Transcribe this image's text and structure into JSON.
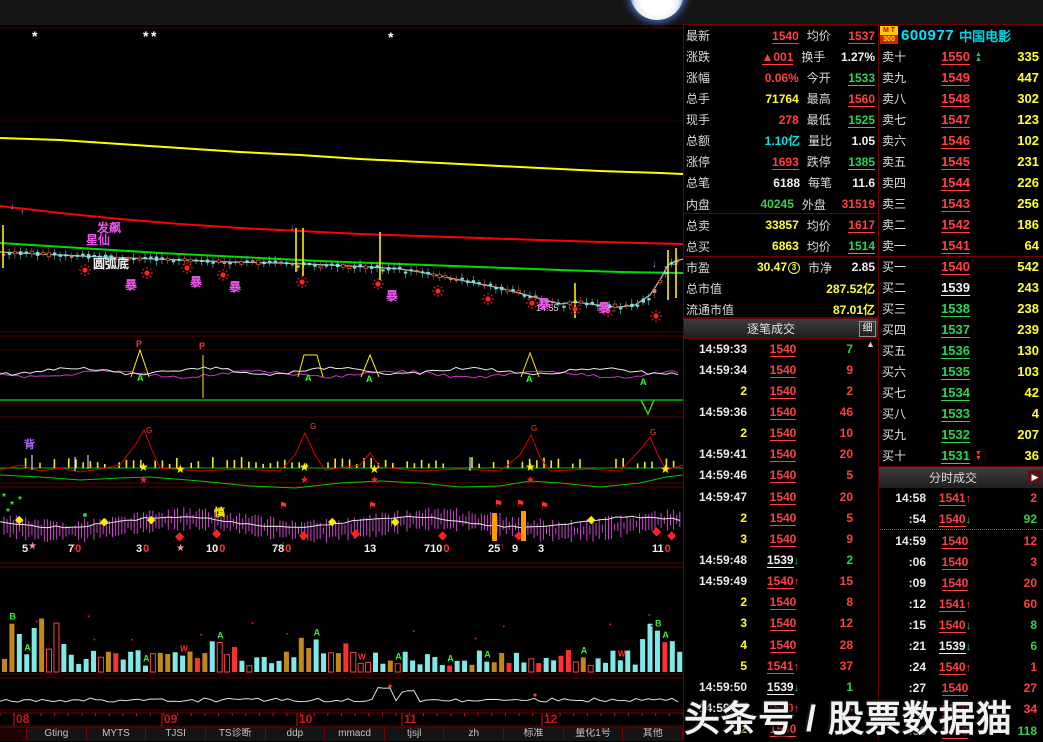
{
  "watermark": "头条号 / 股票数据猫",
  "stock": {
    "badge_top": "M T",
    "badge_bottom": "300",
    "code": "600977",
    "name": "中国电影"
  },
  "icons": {
    "up2": "▲",
    "down2": "▼",
    "up": "↑",
    "down": "↓",
    "scroll_up": "▲",
    "more": "▶",
    "pe_info": "3"
  },
  "quote_rows": [
    {
      "l1": "最新",
      "v1": "1540",
      "c1": "r u",
      "l2": "均价",
      "v2": "1537",
      "c2": "r u"
    },
    {
      "l1": "涨跌",
      "v1": "▲001",
      "c1": "r u",
      "l2": "换手",
      "v2": "1.27%",
      "c2": "w"
    },
    {
      "l1": "涨幅",
      "v1": "0.06%",
      "c1": "r",
      "l2": "今开",
      "v2": "1533",
      "c2": "g u"
    },
    {
      "l1": "总手",
      "v1": "71764",
      "c1": "y",
      "l2": "最高",
      "v2": "1560",
      "c2": "r u"
    },
    {
      "l1": "现手",
      "v1": "278",
      "c1": "r",
      "l2": "最低",
      "v2": "1525",
      "c2": "g u"
    },
    {
      "l1": "总额",
      "v1": "1.10亿",
      "c1": "c",
      "l2": "量比",
      "v2": "1.05",
      "c2": "w"
    },
    {
      "l1": "涨停",
      "v1": "1693",
      "c1": "r u",
      "l2": "跌停",
      "v2": "1385",
      "c2": "g u"
    },
    {
      "l1": "总笔",
      "v1": "6188",
      "c1": "w",
      "l2": "每笔",
      "v2": "11.6",
      "c2": "w"
    },
    {
      "l1": "内盘",
      "v1": "40245",
      "c1": "g",
      "l2": "外盘",
      "v2": "31519",
      "c2": "r"
    },
    {
      "l1": "总卖",
      "v1": "33857",
      "c1": "y",
      "l2": "均价",
      "v2": "1617",
      "c2": "r u"
    },
    {
      "l1": "总买",
      "v1": "6863",
      "c1": "y",
      "l2": "均价",
      "v2": "1514",
      "c2": "g u"
    },
    {
      "l1": "市盈",
      "v1": "30.47",
      "c1": "y",
      "icon1": true,
      "l2": "市净",
      "v2": "2.85",
      "c2": "w"
    }
  ],
  "quote_totals": [
    {
      "label": "总市值",
      "value": "287.52亿"
    },
    {
      "label": "流通市值",
      "value": "87.01亿"
    }
  ],
  "sell_levels": [
    {
      "label": "卖十",
      "price": "1550",
      "pc": "r u",
      "vol": "335",
      "arrow": "up2"
    },
    {
      "label": "卖九",
      "price": "1549",
      "pc": "r u",
      "vol": "447"
    },
    {
      "label": "卖八",
      "price": "1548",
      "pc": "r u",
      "vol": "302"
    },
    {
      "label": "卖七",
      "price": "1547",
      "pc": "r u",
      "vol": "123"
    },
    {
      "label": "卖六",
      "price": "1546",
      "pc": "r u",
      "vol": "102"
    },
    {
      "label": "卖五",
      "price": "1545",
      "pc": "r u",
      "vol": "231"
    },
    {
      "label": "卖四",
      "price": "1544",
      "pc": "r u",
      "vol": "226"
    },
    {
      "label": "卖三",
      "price": "1543",
      "pc": "r u",
      "vol": "256"
    },
    {
      "label": "卖二",
      "price": "1542",
      "pc": "r u",
      "vol": "186"
    },
    {
      "label": "卖一",
      "price": "1541",
      "pc": "r u",
      "vol": "64"
    }
  ],
  "buy_levels": [
    {
      "label": "买一",
      "price": "1540",
      "pc": "r u",
      "vol": "542"
    },
    {
      "label": "买二",
      "price": "1539",
      "pc": "w u",
      "vol": "243"
    },
    {
      "label": "买三",
      "price": "1538",
      "pc": "g u",
      "vol": "238"
    },
    {
      "label": "买四",
      "price": "1537",
      "pc": "g u",
      "vol": "239"
    },
    {
      "label": "买五",
      "price": "1536",
      "pc": "g u",
      "vol": "130"
    },
    {
      "label": "买六",
      "price": "1535",
      "pc": "g u",
      "vol": "103"
    },
    {
      "label": "买七",
      "price": "1534",
      "pc": "g u",
      "vol": "42"
    },
    {
      "label": "买八",
      "price": "1533",
      "pc": "g u",
      "vol": "4"
    },
    {
      "label": "买九",
      "price": "1532",
      "pc": "g u",
      "vol": "207"
    },
    {
      "label": "买十",
      "price": "1531",
      "pc": "g u",
      "vol": "36",
      "arrow": "down2"
    }
  ],
  "tick_trades": {
    "title": "逐笔成交",
    "detail": "细",
    "rows": [
      {
        "t": "14:59:33",
        "p": "1540",
        "pc": "r u",
        "v": "7",
        "vc": "g"
      },
      {
        "t": "14:59:34",
        "p": "1540",
        "pc": "r u",
        "v": "9",
        "vc": "r"
      },
      {
        "t": "2",
        "p": "1540",
        "pc": "r u",
        "v": "2",
        "vc": "r"
      },
      {
        "t": "14:59:36",
        "p": "1540",
        "pc": "r u",
        "v": "46",
        "vc": "r"
      },
      {
        "t": "2",
        "p": "1540",
        "pc": "r u",
        "v": "10",
        "vc": "r"
      },
      {
        "t": "14:59:41",
        "p": "1540",
        "pc": "r u",
        "v": "20",
        "vc": "r"
      },
      {
        "t": "14:59:46",
        "p": "1540",
        "pc": "r u",
        "v": "5",
        "vc": "r"
      },
      {
        "t": "14:59:47",
        "p": "1540",
        "pc": "r u",
        "v": "20",
        "vc": "r"
      },
      {
        "t": "2",
        "p": "1540",
        "pc": "r u",
        "v": "5",
        "vc": "r"
      },
      {
        "t": "3",
        "p": "1540",
        "pc": "r u",
        "v": "9",
        "vc": "r"
      },
      {
        "t": "14:59:48",
        "p": "1539",
        "pc": "w u",
        "dir": "down",
        "v": "2",
        "vc": "g"
      },
      {
        "t": "14:59:49",
        "p": "1540",
        "pc": "r u",
        "dir": "up",
        "v": "15",
        "vc": "r"
      },
      {
        "t": "2",
        "p": "1540",
        "pc": "r u",
        "v": "8",
        "vc": "r"
      },
      {
        "t": "3",
        "p": "1540",
        "pc": "r u",
        "v": "12",
        "vc": "r"
      },
      {
        "t": "4",
        "p": "1540",
        "pc": "r u",
        "v": "28",
        "vc": "r"
      },
      {
        "t": "5",
        "p": "1541",
        "pc": "r u",
        "dir": "up",
        "v": "37",
        "vc": "r"
      },
      {
        "t": "14:59:50",
        "p": "1539",
        "pc": "w u",
        "dir": "down",
        "v": "1",
        "vc": "g"
      },
      {
        "t": "14:59:51",
        "p": "1540",
        "pc": "r u",
        "dir": "up",
        "v": "4",
        "vc": "r"
      },
      {
        "t": "2",
        "p": "1540",
        "pc": "r u",
        "v": "5",
        "vc": "r"
      }
    ]
  },
  "minute_trades": {
    "title": "分时成交",
    "rows": [
      {
        "t": "14:58",
        "p": "1541",
        "pc": "r u",
        "dir": "up",
        "v": "2",
        "vc": "r"
      },
      {
        "t": ":54",
        "p": "1540",
        "pc": "r u",
        "dir": "down",
        "v": "92",
        "vc": "g",
        "sep": true
      },
      {
        "t": "14:59",
        "p": "1540",
        "pc": "r u",
        "v": "12",
        "vc": "r"
      },
      {
        "t": ":06",
        "p": "1540",
        "pc": "r u",
        "v": "3",
        "vc": "r"
      },
      {
        "t": ":09",
        "p": "1540",
        "pc": "r u",
        "v": "20",
        "vc": "r"
      },
      {
        "t": ":12",
        "p": "1541",
        "pc": "r u",
        "dir": "up",
        "v": "60",
        "vc": "r"
      },
      {
        "t": ":15",
        "p": "1540",
        "pc": "r u",
        "dir": "down",
        "v": "8",
        "vc": "g"
      },
      {
        "t": ":21",
        "p": "1539",
        "pc": "w u",
        "dir": "down",
        "v": "6",
        "vc": "g"
      },
      {
        "t": ":24",
        "p": "1540",
        "pc": "r u",
        "dir": "up",
        "v": "1",
        "vc": "r"
      },
      {
        "t": ":27",
        "p": "1540",
        "pc": "r u",
        "v": "27",
        "vc": "r"
      },
      {
        "t": ":30",
        "p": "1540",
        "pc": "r u",
        "v": "34",
        "vc": "r"
      },
      {
        "t": ":36",
        "p": "1540",
        "pc": "r u",
        "v": "118",
        "vc": "g"
      }
    ]
  },
  "chart": {
    "x_labels": [
      "08",
      "09",
      "10",
      "11",
      "12"
    ],
    "tabs": [
      "Gting",
      "MYTS",
      "TJSI",
      "TS诊断",
      "ddp",
      "mmacd",
      "tjsjl",
      "zh",
      "标准",
      "量化1号",
      "其他"
    ],
    "labels": {
      "trend1": "发飙",
      "trend2": "星仙",
      "pattern": "圆弧底",
      "bao": "暴",
      "time_note": "14:55",
      "shen": "慎",
      "bei": "背"
    },
    "letters": {
      "a": "A",
      "b": "B",
      "p": "P",
      "g": "G",
      "v": "V",
      "w": "W"
    },
    "pane4_numbers": [
      {
        "n": "5"
      },
      {
        "n": "7",
        "z": "0"
      },
      {
        "n": "3",
        "z": "0"
      },
      {
        "n": "10",
        "z": "0"
      },
      {
        "n": "78",
        "z": "0"
      },
      {
        "n": "13"
      },
      {
        "n": "710",
        "z": "0"
      },
      {
        "n": "25"
      },
      {
        "n": "9"
      },
      {
        "n": "3"
      },
      {
        "n": "11",
        "z": "0"
      }
    ]
  }
}
